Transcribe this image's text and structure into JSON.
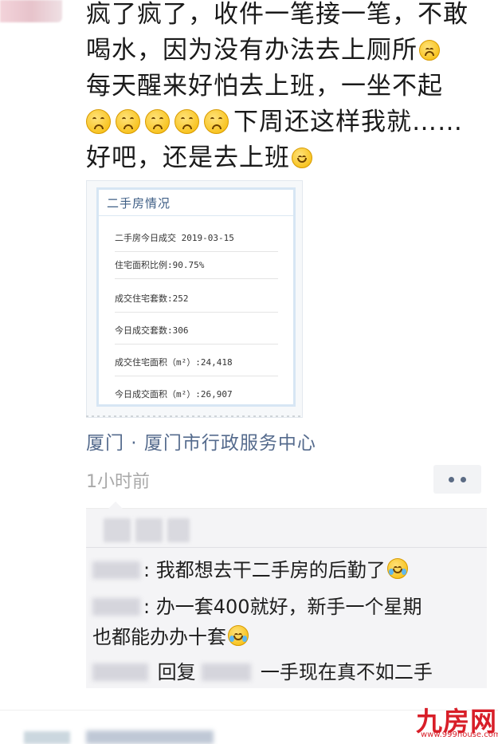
{
  "post": {
    "lines": [
      "疯了疯了，收件一笔接一笔，不敢",
      "喝水，因为没有办法去上厕所",
      "每天醒来好怕去上班，一坐不起",
      "下周还这样我就……",
      "好吧，还是去上班"
    ]
  },
  "shared_card": {
    "title": "二手房情况",
    "rows": [
      "二手房今日成交 2019-03-15",
      "住宅面积比例:90.75%",
      "成交住宅套数:252",
      "今日成交套数:306",
      "成交住宅面积（m²）:24,418",
      "今日成交面积（m²）:26,907"
    ]
  },
  "location": "厦门 · 厦门市行政服务中心",
  "timestamp": "1小时前",
  "comments": [
    {
      "separator": ":",
      "text": "我都想去干二手房的后勤了"
    },
    {
      "separator": ":",
      "text": "办一套400就好，新手一个星期"
    },
    {
      "text": "也都能办办十套"
    },
    {
      "reply_word": "回复",
      "text": "一手现在真不如二手"
    }
  ],
  "watermark": {
    "brand": "九房网",
    "url": "www.999house.com"
  },
  "icons": {
    "emoji_cry": "crying-face-icon",
    "emoji_smile": "smile-face-icon",
    "emoji_laugh": "tears-of-joy-icon",
    "more": "more-dots-icon"
  },
  "colors": {
    "link_blue": "#556b8d",
    "time_gray": "#a9a9a9",
    "watermark_red": "#d81e28"
  }
}
